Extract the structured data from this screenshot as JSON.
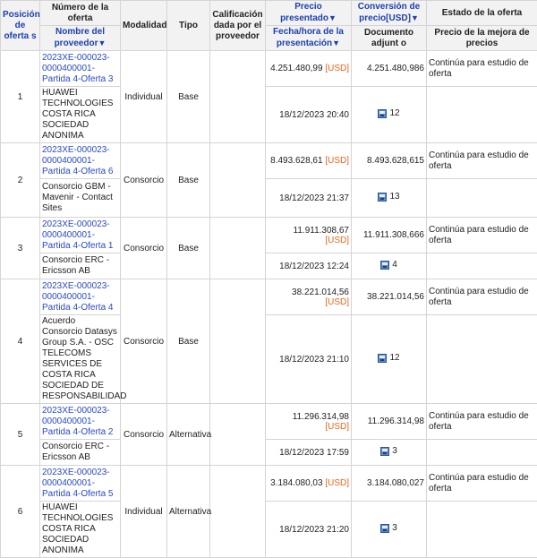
{
  "headers": {
    "posicion": "Posición de oferta s",
    "numero": "Número de la oferta",
    "nombre_proveedor": "Nombre del proveedor",
    "modalidad": "Modalidad",
    "tipo": "Tipo",
    "calificacion": "Calificación dada por el proveedor",
    "precio": "Precio presentado",
    "fecha": "Fecha/hora de la presentación",
    "conversion": "Conversión de precio[USD]",
    "documento": "Documento adjunt o",
    "estado": "Estado de la oferta",
    "mejora": "Precio de la mejora de precios",
    "sort_arrow": "▼"
  },
  "rows": [
    {
      "pos": "1",
      "offer": "2023XE-000023-0000400001-Partida 4-Oferta 3",
      "supplier": "HUAWEI TECHNOLOGIES COSTA RICA SOCIEDAD ANONIMA",
      "modalidad": "Individual",
      "tipo": "Base",
      "price": "4.251.480,99",
      "currency": "[USD]",
      "conv": "4.251.480,986",
      "fecha": "18/12/2023 20:40",
      "docs": "12",
      "estado": "Continúa para estudio de oferta"
    },
    {
      "pos": "2",
      "offer": "2023XE-000023-0000400001-Partida 4-Oferta 6",
      "supplier": "Consorcio GBM - Mavenir - Contact Sites",
      "modalidad": "Consorcio",
      "tipo": "Base",
      "price": "8.493.628,61",
      "currency": "[USD]",
      "conv": "8.493.628,615",
      "fecha": "18/12/2023 21:37",
      "docs": "13",
      "estado": "Continúa para estudio de oferta"
    },
    {
      "pos": "3",
      "offer": "2023XE-000023-0000400001-Partida 4-Oferta 1",
      "supplier": "Consorcio ERC - Ericsson AB",
      "modalidad": "Consorcio",
      "tipo": "Base",
      "price": "11.911.308,67",
      "currency": "[USD]",
      "conv": "11.911.308,666",
      "fecha": "18/12/2023 12:24",
      "docs": "4",
      "estado": "Continúa para estudio de oferta"
    },
    {
      "pos": "4",
      "offer": "2023XE-000023-0000400001-Partida 4-Oferta 4",
      "supplier": "Acuerdo Consorcio Datasys Group S.A. - OSC TELECOMS SERVICES DE COSTA RICA SOCIEDAD DE RESPONSABILIDAD",
      "modalidad": "Consorcio",
      "tipo": "Base",
      "price": "38.221.014,56",
      "currency": "[USD]",
      "conv": "38.221.014,56",
      "fecha": "18/12/2023 21:10",
      "docs": "12",
      "estado": "Continúa para estudio de oferta"
    },
    {
      "pos": "5",
      "offer": "2023XE-000023-0000400001-Partida 4-Oferta 2",
      "supplier": "Consorcio ERC - Ericsson AB",
      "modalidad": "Consorcio",
      "tipo": "Alternativa",
      "price": "11.296.314,98",
      "currency": "[USD]",
      "conv": "11.296.314,98",
      "fecha": "18/12/2023 17:59",
      "docs": "3",
      "estado": "Continúa para estudio de oferta"
    },
    {
      "pos": "6",
      "offer": "2023XE-000023-0000400001-Partida 4-Oferta 5",
      "supplier": "HUAWEI TECHNOLOGIES COSTA RICA SOCIEDAD ANONIMA",
      "modalidad": "Individual",
      "tipo": "Alternativa",
      "price": "3.184.080,03",
      "currency": "[USD]",
      "conv": "3.184.080,027",
      "fecha": "18/12/2023 21:20",
      "docs": "3",
      "estado": "Continúa para estudio de oferta"
    }
  ]
}
